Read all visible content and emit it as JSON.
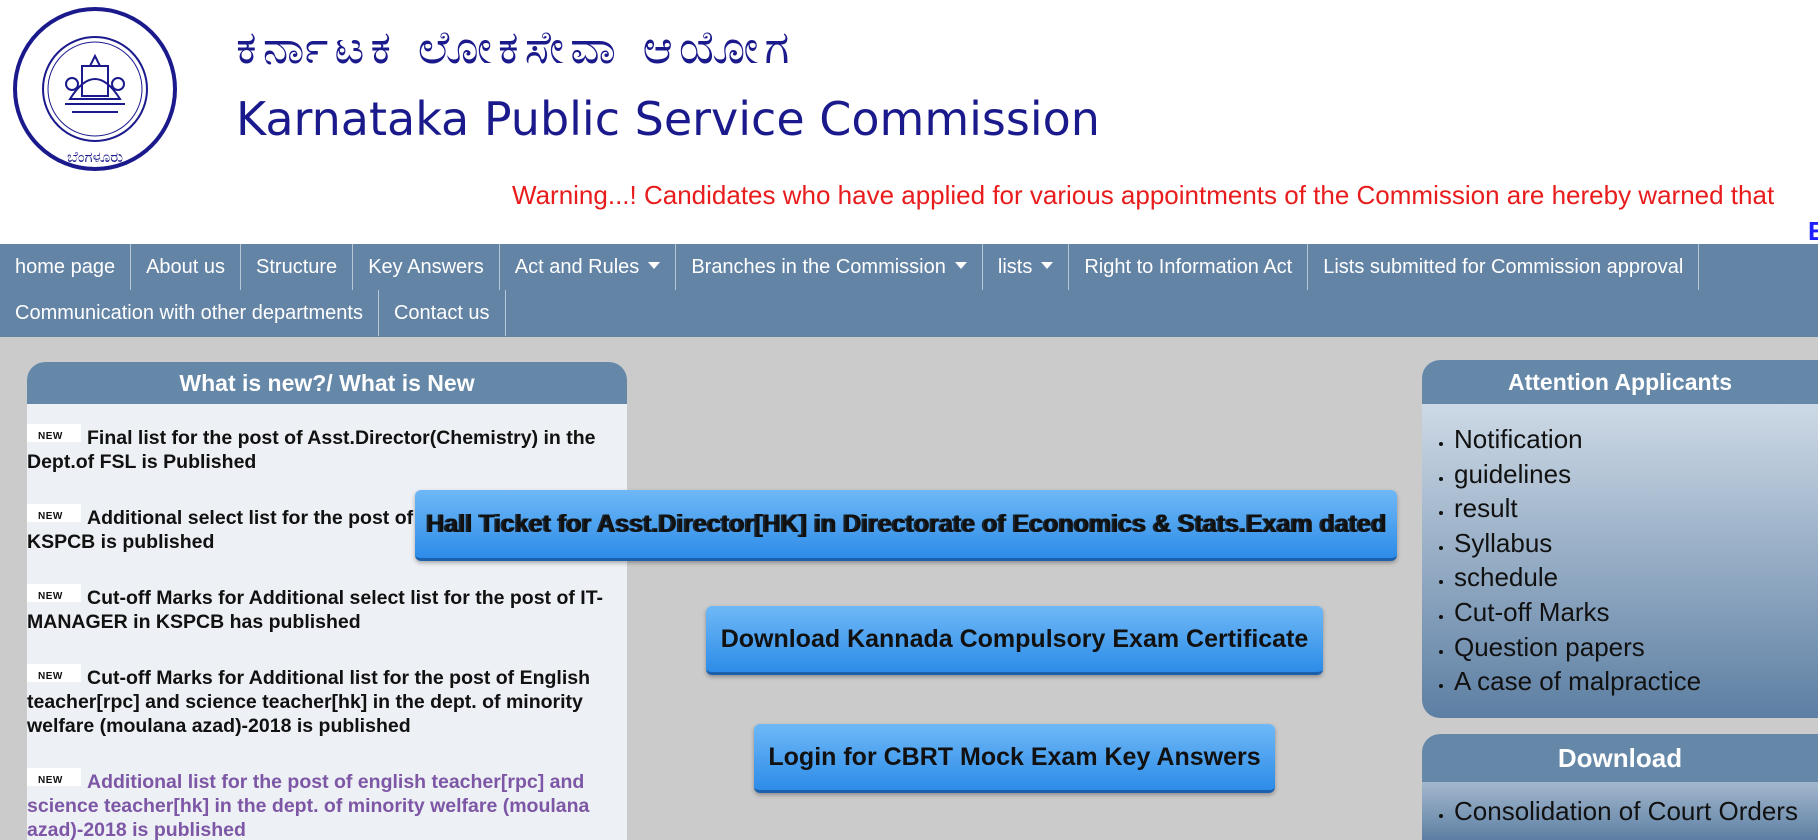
{
  "header": {
    "title_kannada": "ಕರ್ನಾಟಕ ಲೋಕಸೇವಾ ಆಯೋಗ",
    "title_english": "Karnataka Public Service Commission",
    "logo_top_text": "ಕರ್ನಾಟಕ ಲೋಕಸೇವಾ ಆಯೋಗ",
    "logo_bottom_text": "ಬೆಂಗಳೂರು",
    "warning": "Warning...! Candidates who have applied for various appointments of the Commission are hereby warned that",
    "marquee_fragment": "E"
  },
  "nav": {
    "row1": [
      {
        "label": "home page"
      },
      {
        "label": "About us"
      },
      {
        "label": "Structure"
      },
      {
        "label": "Key Answers"
      },
      {
        "label": "Act and Rules"
      },
      {
        "label": "Branches in the Commission"
      },
      {
        "label": "lists"
      },
      {
        "label": "Right to Information Act"
      },
      {
        "label": "Lists submitted for Commission approval"
      }
    ],
    "row2": [
      {
        "label": "Communication with other departments"
      },
      {
        "label": "Contact us"
      }
    ]
  },
  "whats_new": {
    "heading": "What is new?/ What is New",
    "badge": "NEW",
    "items": [
      {
        "text": "Final list for the post of Asst.Director(Chemistry) in the Dept.of FSL is Published"
      },
      {
        "text": "Additional select list for the post of IT-MANAGER in KSPCB is published"
      },
      {
        "text": "Cut-off Marks for Additional select list for the post of IT-MANAGER in KSPCB has published"
      },
      {
        "text": "Cut-off Marks for Additional list for the post of English teacher[rpc] and science teacher[hk] in the dept. of minority welfare (moulana azad)-2018 is published"
      },
      {
        "text": "Additional list for the post of english teacher[rpc] and science teacher[hk] in the dept. of minority welfare (moulana azad)-2018 is published"
      }
    ]
  },
  "buttons": {
    "hall_ticket": "Hall Ticket for Asst.Director[HK] in Directorate of Economics & Stats.Exam dated",
    "hall_ticket_overlap": "Hall Ticket for Asst.Director[HK] in Directorate of Economics & Stats.Exam dated",
    "kannada_certificate": "Download Kannada Compulsory Exam Certificate",
    "cbrt_mock": "Login for CBRT Mock Exam Key Answers"
  },
  "attention": {
    "heading": "Attention Applicants",
    "items": [
      {
        "label": "Notification"
      },
      {
        "label": "guidelines"
      },
      {
        "label": "result"
      },
      {
        "label": "Syllabus"
      },
      {
        "label": "schedule"
      },
      {
        "label": "Cut-off Marks"
      },
      {
        "label": "Question papers"
      },
      {
        "label": "A case of malpractice"
      }
    ]
  },
  "download": {
    "heading": "Download",
    "items": [
      {
        "label": "Consolidation of Court Orders"
      }
    ]
  },
  "colors": {
    "nav_bg": "#6484a5",
    "title": "#1a1a8c",
    "warning": "#e81c1c",
    "button": "#3d95ec"
  }
}
